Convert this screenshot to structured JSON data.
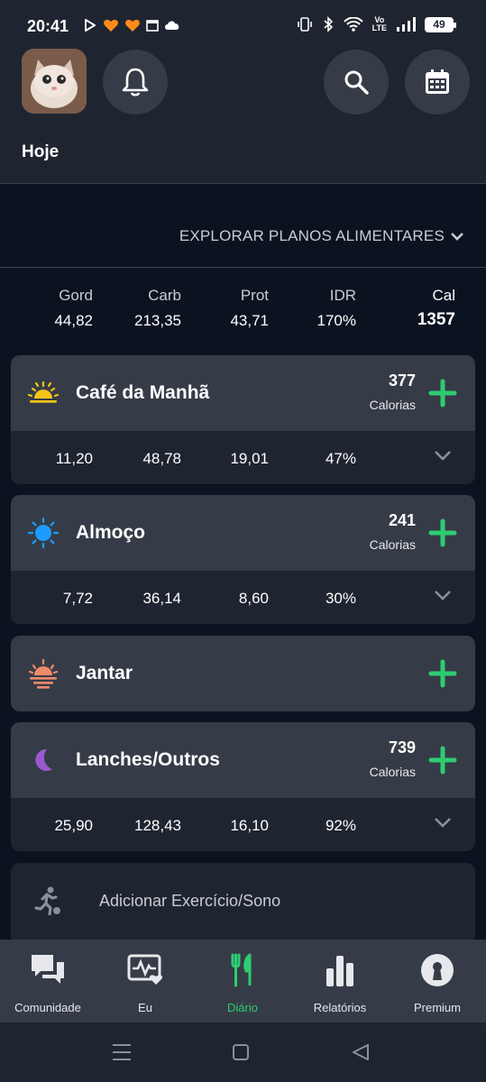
{
  "status_bar": {
    "time": "20:41",
    "volte_top": "Vo",
    "volte_bottom": "LTE",
    "battery": "49"
  },
  "header": {
    "avatar_icon": "cat-photo",
    "title": "Hoje"
  },
  "explore": {
    "label": "EXPLORAR PLANOS ALIMENTARES"
  },
  "totals": {
    "fat": {
      "label": "Gord",
      "value": "44,82"
    },
    "carb": {
      "label": "Carb",
      "value": "213,35"
    },
    "prot": {
      "label": "Prot",
      "value": "43,71"
    },
    "idr": {
      "label": "IDR",
      "value": "170%"
    },
    "cal": {
      "label": "Cal",
      "value": "1357"
    }
  },
  "meals": [
    {
      "title": "Café da Manhã",
      "calories": "377",
      "unit": "Calorias",
      "fat": "11,20",
      "carb": "48,78",
      "prot": "19,01",
      "idr": "47%"
    },
    {
      "title": "Almoço",
      "calories": "241",
      "unit": "Calorias",
      "fat": "7,72",
      "carb": "36,14",
      "prot": "8,60",
      "idr": "30%"
    },
    {
      "title": "Jantar"
    },
    {
      "title": "Lanches/Outros",
      "calories": "739",
      "unit": "Calorias",
      "fat": "25,90",
      "carb": "128,43",
      "prot": "16,10",
      "idr": "92%"
    }
  ],
  "exercise": {
    "label": "Adicionar Exercício/Sono"
  },
  "nav": [
    {
      "label": "Comunidade",
      "icon": "chat-icon"
    },
    {
      "label": "Eu",
      "icon": "heart-pulse-icon"
    },
    {
      "label": "Diário",
      "icon": "fork-knife-icon",
      "active": true
    },
    {
      "label": "Relatórios",
      "icon": "bar-chart-icon"
    },
    {
      "label": "Premium",
      "icon": "keyhole-icon"
    }
  ],
  "colors": {
    "accent_green": "#2ecc71",
    "background": "#0c1320",
    "card": "#1f2530",
    "card_header": "#363c47"
  }
}
